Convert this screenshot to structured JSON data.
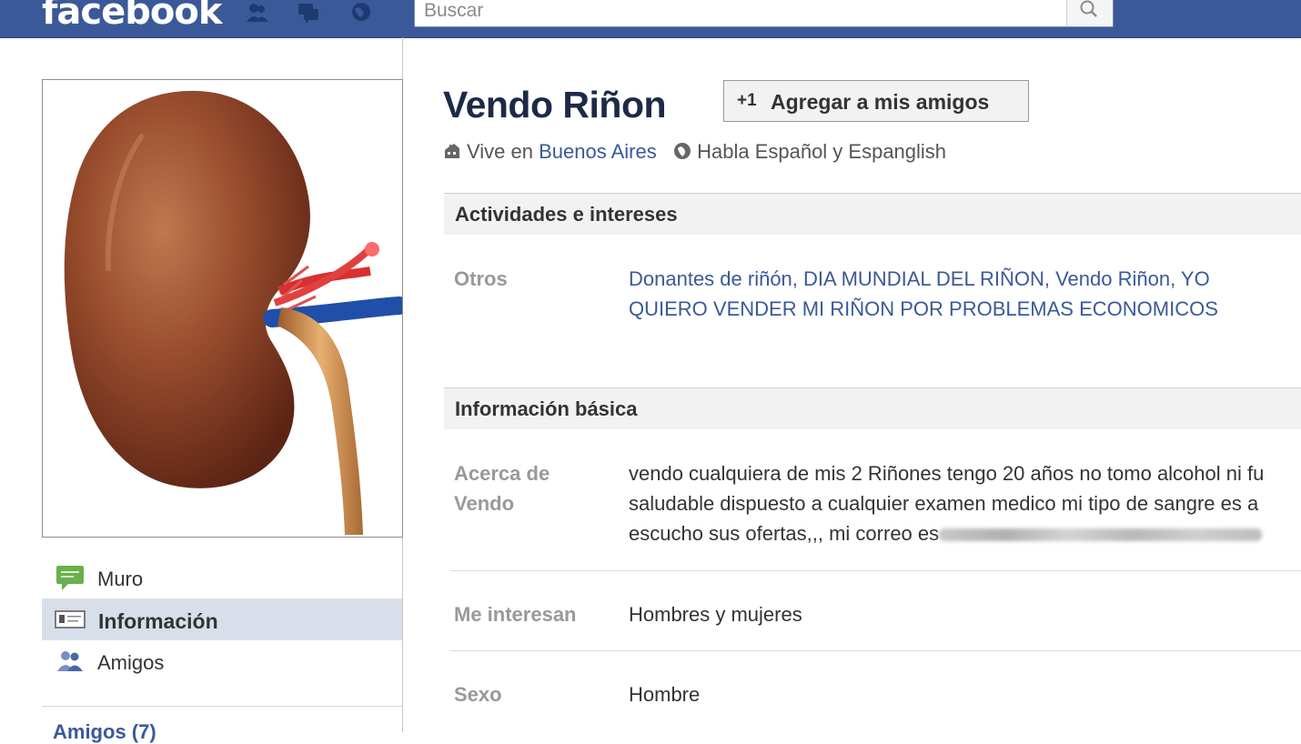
{
  "topbar": {
    "logo": "facebook",
    "search_placeholder": "Buscar"
  },
  "nav": {
    "items": [
      {
        "label": "Muro",
        "icon": "wall-icon"
      },
      {
        "label": "Información",
        "icon": "info-card-icon",
        "active": true
      },
      {
        "label": "Amigos",
        "icon": "friends-icon"
      }
    ],
    "friends_heading": "Amigos (7)"
  },
  "profile": {
    "name": "Vendo Riñon",
    "add_friend_plus": "+1",
    "add_friend_label": "Agregar a mis amigos",
    "lives_prefix": "Vive en",
    "lives_city": "Buenos Aires",
    "speaks": "Habla Español y Espanglish"
  },
  "activities": {
    "heading": "Actividades e intereses",
    "other_label": "Otros",
    "other_line1": "Donantes de riñón, DIA MUNDIAL DEL RIÑON, Vendo Riñon, YO",
    "other_line2": "QUIERO VENDER MI RIÑON POR PROBLEMAS ECONOMICOS"
  },
  "basic_info": {
    "heading": "Información básica",
    "about_label_line1": "Acerca de",
    "about_label_line2": "Vendo",
    "about_line1": "vendo cualquiera de mis 2 Riñones tengo 20 años no tomo alcohol ni fu",
    "about_line2": "saludable dispuesto a cualquier examen medico mi tipo de sangre es a",
    "about_line3": "escucho sus ofertas,,, mi correo es",
    "interested_label": "Me interesan",
    "interested_value": "Hombres y mujeres",
    "sex_label": "Sexo",
    "sex_value": "Hombre"
  },
  "colors": {
    "topbar": "#3b5998",
    "link": "#3b5998",
    "active_nav": "#d8dfea"
  }
}
